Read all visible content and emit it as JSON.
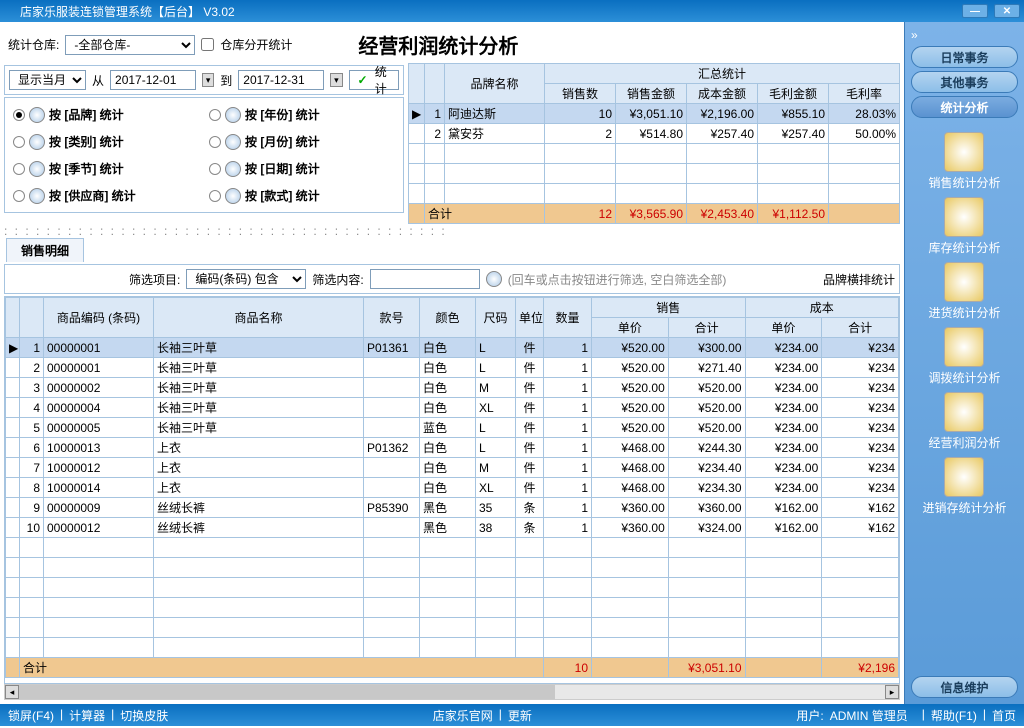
{
  "window": {
    "title": "店家乐服装连锁管理系统【后台】 V3.02"
  },
  "top": {
    "warehouseLbl": "统计仓库:",
    "warehouseAll": "-全部仓库-",
    "splitChk": "仓库分开统计",
    "pageTitle": "经营利润统计分析",
    "showLbl": "显示当月",
    "fromLbl": "从",
    "fromDate": "2017-12-01",
    "toLbl": "到",
    "toDate": "2017-12-31",
    "statBtn": "统计"
  },
  "radios": {
    "brand": "按 [品牌] 统计",
    "year": "按 [年份] 统计",
    "category": "按 [类别] 统计",
    "month": "按 [月份] 统计",
    "season": "按 [季节] 统计",
    "date": "按 [日期] 统计",
    "supplier": "按 [供应商] 统计",
    "style": "按 [款式] 统计"
  },
  "summary": {
    "brandHdr": "品牌名称",
    "groupHdr": "汇总统计",
    "cols": {
      "qty": "销售数",
      "amt": "销售金额",
      "cost": "成本金额",
      "profit": "毛利金额",
      "rate": "毛利率"
    },
    "rows": [
      {
        "n": 1,
        "name": "阿迪达斯",
        "qty": 10,
        "amt": "¥3,051.10",
        "cost": "¥2,196.00",
        "profit": "¥855.10",
        "rate": "28.03%"
      },
      {
        "n": 2,
        "name": "黛安芬",
        "qty": 2,
        "amt": "¥514.80",
        "cost": "¥257.40",
        "profit": "¥257.40",
        "rate": "50.00%"
      }
    ],
    "foot": {
      "lbl": "合计",
      "qty": 12,
      "amt": "¥3,565.90",
      "cost": "¥2,453.40",
      "profit": "¥1,112.50"
    }
  },
  "filter": {
    "tab": "销售明细",
    "itemLbl": "筛选项目:",
    "itemVal": "编码(条码) 包含",
    "contentLbl": "筛选内容:",
    "hint": "(回车或点击按钮进行筛选, 空白筛选全部)",
    "layoutBtn": "品牌横排统计"
  },
  "detail": {
    "hdr": {
      "code": "商品编码 (条码)",
      "name": "商品名称",
      "sku": "款号",
      "color": "颜色",
      "size": "尺码",
      "unit": "单位",
      "qty": "数量",
      "salesGrp": "销售",
      "costGrp": "成本",
      "price": "单价",
      "total": "合计"
    },
    "rows": [
      {
        "n": 1,
        "code": "00000001",
        "name": "长袖三叶草",
        "sku": "P01361",
        "color": "白色",
        "size": "L",
        "unit": "件",
        "qty": 1,
        "p": "¥520.00",
        "t": "¥300.00",
        "cp": "¥234.00",
        "ct": "¥234"
      },
      {
        "n": 2,
        "code": "00000001",
        "name": "长袖三叶草",
        "sku": "",
        "color": "白色",
        "size": "L",
        "unit": "件",
        "qty": 1,
        "p": "¥520.00",
        "t": "¥271.40",
        "cp": "¥234.00",
        "ct": "¥234"
      },
      {
        "n": 3,
        "code": "00000002",
        "name": "长袖三叶草",
        "sku": "",
        "color": "白色",
        "size": "M",
        "unit": "件",
        "qty": 1,
        "p": "¥520.00",
        "t": "¥520.00",
        "cp": "¥234.00",
        "ct": "¥234"
      },
      {
        "n": 4,
        "code": "00000004",
        "name": "长袖三叶草",
        "sku": "",
        "color": "白色",
        "size": "XL",
        "unit": "件",
        "qty": 1,
        "p": "¥520.00",
        "t": "¥520.00",
        "cp": "¥234.00",
        "ct": "¥234"
      },
      {
        "n": 5,
        "code": "00000005",
        "name": "长袖三叶草",
        "sku": "",
        "color": "蓝色",
        "size": "L",
        "unit": "件",
        "qty": 1,
        "p": "¥520.00",
        "t": "¥520.00",
        "cp": "¥234.00",
        "ct": "¥234"
      },
      {
        "n": 6,
        "code": "10000013",
        "name": "上衣",
        "sku": "P01362",
        "color": "白色",
        "size": "L",
        "unit": "件",
        "qty": 1,
        "p": "¥468.00",
        "t": "¥244.30",
        "cp": "¥234.00",
        "ct": "¥234"
      },
      {
        "n": 7,
        "code": "10000012",
        "name": "上衣",
        "sku": "",
        "color": "白色",
        "size": "M",
        "unit": "件",
        "qty": 1,
        "p": "¥468.00",
        "t": "¥234.40",
        "cp": "¥234.00",
        "ct": "¥234"
      },
      {
        "n": 8,
        "code": "10000014",
        "name": "上衣",
        "sku": "",
        "color": "白色",
        "size": "XL",
        "unit": "件",
        "qty": 1,
        "p": "¥468.00",
        "t": "¥234.30",
        "cp": "¥234.00",
        "ct": "¥234"
      },
      {
        "n": 9,
        "code": "00000009",
        "name": "丝绒长裤",
        "sku": "P85390",
        "color": "黑色",
        "size": "35",
        "unit": "条",
        "qty": 1,
        "p": "¥360.00",
        "t": "¥360.00",
        "cp": "¥162.00",
        "ct": "¥162"
      },
      {
        "n": 10,
        "code": "00000012",
        "name": "丝绒长裤",
        "sku": "",
        "color": "黑色",
        "size": "38",
        "unit": "条",
        "qty": 1,
        "p": "¥360.00",
        "t": "¥324.00",
        "cp": "¥162.00",
        "ct": "¥162"
      }
    ],
    "foot": {
      "lbl": "合计",
      "qty": 10,
      "t": "¥3,051.10",
      "ct": "¥2,196"
    }
  },
  "sidebar": {
    "arrows": "»",
    "top": [
      {
        "id": "daily",
        "txt": "日常事务"
      },
      {
        "id": "other",
        "txt": "其他事务"
      },
      {
        "id": "stats",
        "txt": "统计分析",
        "active": true
      }
    ],
    "items": [
      {
        "id": "sales",
        "txt": "销售统计分析"
      },
      {
        "id": "stock",
        "txt": "库存统计分析"
      },
      {
        "id": "in",
        "txt": "进货统计分析"
      },
      {
        "id": "move",
        "txt": "调拨统计分析"
      },
      {
        "id": "profit",
        "txt": "经营利润分析"
      },
      {
        "id": "inout",
        "txt": "进销存统计分析"
      }
    ],
    "bottom": {
      "id": "info",
      "txt": "信息维护"
    }
  },
  "status": {
    "left": [
      "锁屏(F4)",
      "计算器",
      "切换皮肤"
    ],
    "center": [
      "店家乐官网",
      "更新"
    ],
    "right": [
      "用户:",
      "ADMIN 管理员",
      "帮助(F1)",
      "首页"
    ]
  }
}
